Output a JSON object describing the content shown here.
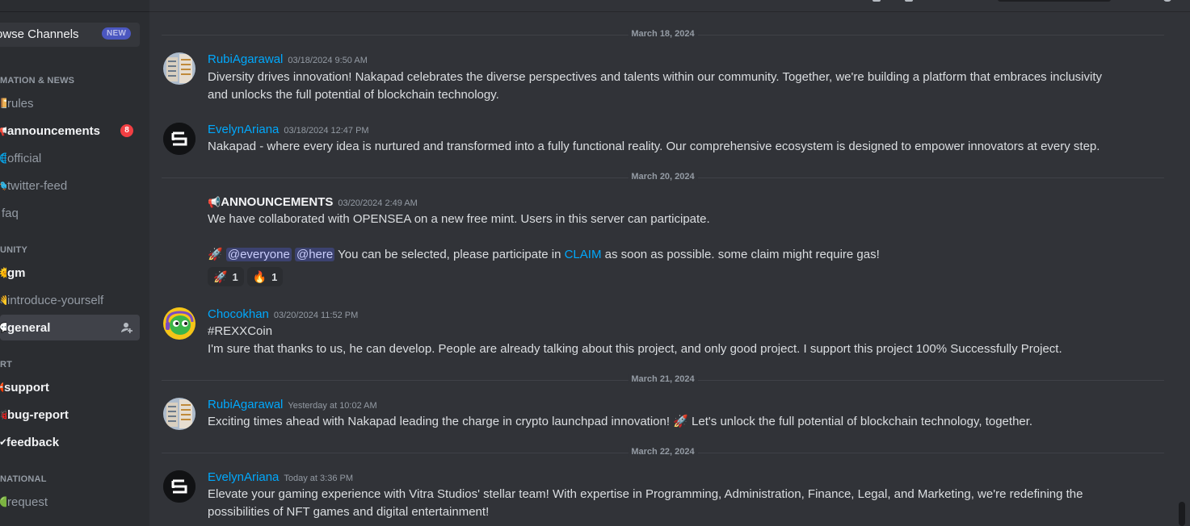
{
  "sidebar": {
    "browse": {
      "label": "rowse Channels",
      "badge": "NEW"
    },
    "categories": [
      {
        "label": "MATION & NEWS"
      },
      {
        "label": "UNITY"
      },
      {
        "label": "RT"
      },
      {
        "label": "NATIONAL"
      }
    ],
    "channels": [
      {
        "label": "rules",
        "icon": "book-emoji"
      },
      {
        "label": "announcements",
        "icon": "megaphone-emoji",
        "unread_count": "8"
      },
      {
        "label": "official",
        "icon": "globe-emoji"
      },
      {
        "label": "twitter-feed",
        "icon": "bird-emoji"
      },
      {
        "label": "faq",
        "icon": "question-emoji"
      },
      {
        "label": "gm",
        "icon": "sun-emoji"
      },
      {
        "label": "introduce-yourself",
        "icon": "wave-emoji"
      },
      {
        "label": "general",
        "icon": "chat-emoji"
      },
      {
        "label": "support",
        "icon": "support-emoji"
      },
      {
        "label": "bug-report",
        "icon": "bug-emoji"
      },
      {
        "label": "feedback",
        "icon": "check-emoji"
      },
      {
        "label": "request",
        "icon": "green-circle-emoji"
      }
    ]
  },
  "dividers": [
    "March 18, 2024",
    "March 20, 2024",
    "March 21, 2024",
    "March 22, 2024"
  ],
  "messages": [
    {
      "author": "RubiAgarawal",
      "timestamp": "03/18/2024 9:50 AM",
      "lines": [
        "Diversity drives innovation! Nakapad celebrates the diverse perspectives and talents within our community. Together, we're building a platform that embraces inclusivity",
        "and unlocks the full potential of blockchain technology."
      ]
    },
    {
      "author": "EvelynAriana",
      "timestamp": "03/18/2024 12:47 PM",
      "lines": [
        "Nakapad - where every idea is nurtured and transformed into a fully functional reality. Our comprehensive ecosystem is designed to empower innovators at every step."
      ]
    },
    {
      "author": "ANNOUNCEMENTS",
      "author_icon": "📢",
      "timestamp": "03/20/2024 2:49 AM",
      "lines": [
        "We have collaborated with OPENSEA on a new free mint. Users in this server can participate."
      ],
      "line2": {
        "emoji": "🚀",
        "mention1": "@everyone",
        "mention2": "@here",
        "text_before_link": " You can be selected, please participate in ",
        "link": "CLAIM",
        "text_after_link": " as soon as possible. some claim might require gas!"
      },
      "reactions": [
        {
          "emoji": "🚀",
          "count": "1"
        },
        {
          "emoji": "🔥",
          "count": "1"
        }
      ]
    },
    {
      "author": "Chocokhan",
      "timestamp": "03/20/2024 11:52 PM",
      "lines": [
        "#REXXCoin",
        "I'm sure that thanks to us, he can develop. People are already talking about this project, and only good project. I support this project 100% Successfully Project."
      ]
    },
    {
      "author": "RubiAgarawal",
      "timestamp": "Yesterday at 10:02 AM",
      "text_before_emoji": "Exciting times ahead with Nakapad leading the charge in crypto launchpad innovation! ",
      "emoji": "🚀",
      "text_after_emoji": " Let's unlock the full potential of blockchain technology, together."
    },
    {
      "author": "EvelynAriana",
      "timestamp": "Today at 3:36 PM",
      "lines": [
        "Elevate your gaming experience with Vitra Studios' stellar team! With expertise in Programming, Administration, Finance, Legal, and Marketing, we're redefining the",
        "possibilities of NFT games and digital entertainment!"
      ]
    }
  ],
  "colors": {
    "accent": "#00a8fc",
    "background": "#313338",
    "sidebar": "#2b2d31",
    "badge": "#f23f43"
  }
}
